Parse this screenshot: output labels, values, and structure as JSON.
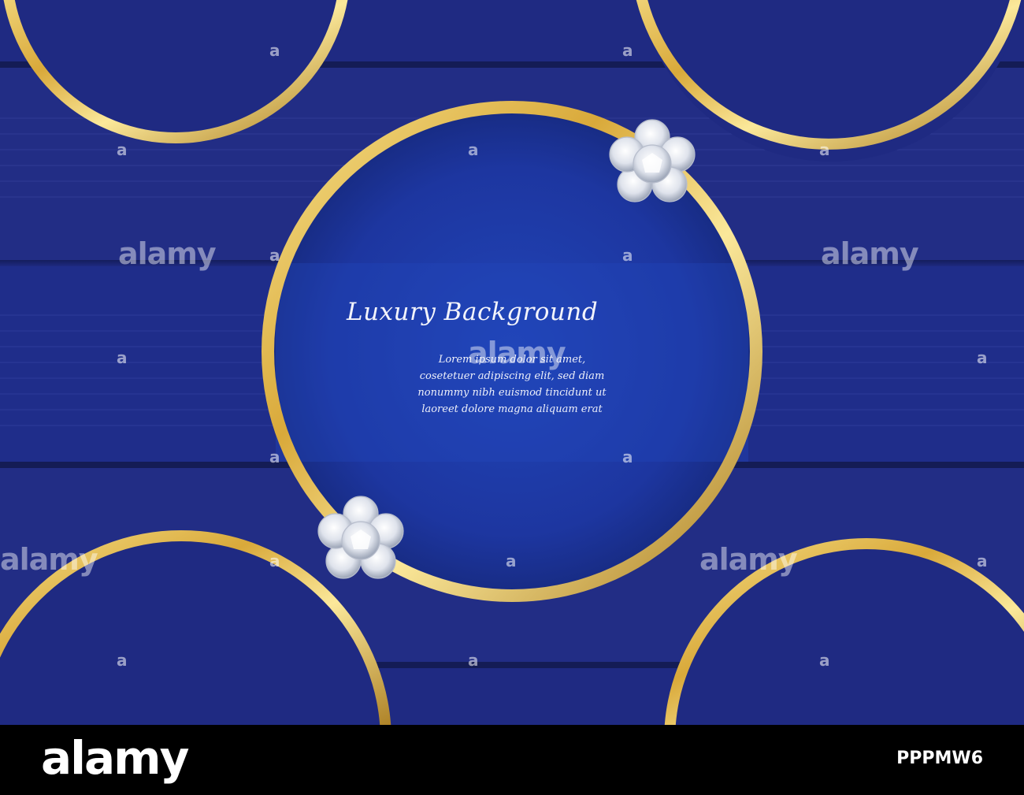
{
  "artwork": {
    "headline": "Luxury Background",
    "body_lines": [
      "Lorem ipsum dolor sit amet,",
      "cosetetuer adipiscing elit, sed diam",
      "nonummy nibh euismod tincidunt ut",
      "laoreet dolore magna aliquam erat"
    ],
    "colors": {
      "background": "#1c2777",
      "panel": "#222b80",
      "center_circle": "#1e3aa8",
      "gold": "#d9a93a",
      "diamond": "#eef0f6"
    }
  },
  "watermark": {
    "text": "alamy",
    "mark": "a"
  },
  "footer": {
    "logo": "alamy",
    "image_id": "PPPMW6"
  }
}
